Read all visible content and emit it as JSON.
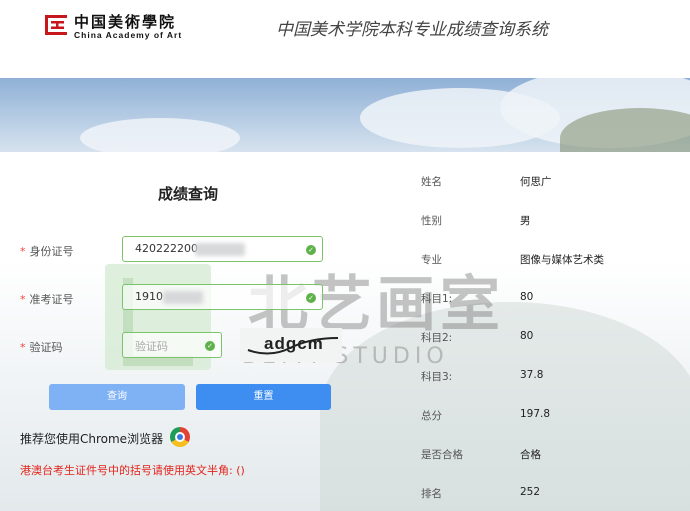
{
  "header": {
    "logo_cn": "中国美術學院",
    "logo_en": "China Academy of Art",
    "system_title": "中国美术学院本科专业成绩查询系统"
  },
  "form": {
    "title": "成绩查询",
    "id_label": "身份证号",
    "id_value": "420222200",
    "exam_label": "准考证号",
    "exam_value": "1910",
    "captcha_label": "验证码",
    "captcha_placeholder": "验证码",
    "captcha_text": "adgcm",
    "required_mark": "*",
    "query_button": "查询",
    "reset_button": "重置"
  },
  "tips": {
    "chrome": "推荐您使用Chrome浏览器",
    "hk": "港澳台考生证件号中的括号请使用英文半角: ()"
  },
  "watermark": {
    "text": "北艺画室",
    "subtext": "BEIYI STUDIO"
  },
  "result": [
    {
      "label": "姓名",
      "value": "何思广"
    },
    {
      "label": "性别",
      "value": "男"
    },
    {
      "label": "专业",
      "value": "图像与媒体艺术类"
    },
    {
      "label": "科目1:",
      "value": "80"
    },
    {
      "label": "科目2:",
      "value": "80"
    },
    {
      "label": "科目3:",
      "value": "37.8"
    },
    {
      "label": "总分",
      "value": "197.8"
    },
    {
      "label": "是否合格",
      "value": "合格"
    },
    {
      "label": "排名",
      "value": "252"
    }
  ],
  "colors": {
    "accent": "#3d8ef0",
    "success": "#5fb14c",
    "warning_text": "#e3241b",
    "brand_red": "#c8161d"
  }
}
